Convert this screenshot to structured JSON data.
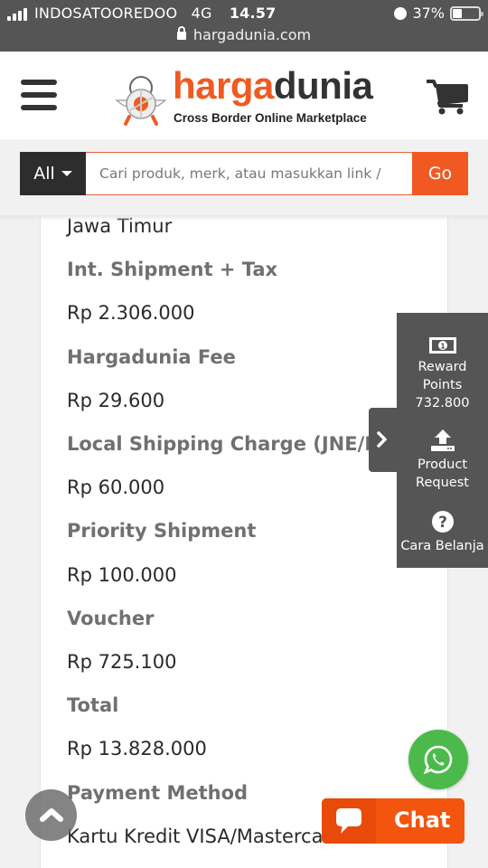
{
  "status_bar": {
    "carrier": "INDOSATOOREDOO",
    "network": "4G",
    "time": "14.57",
    "battery_percent": "37%",
    "battery_level": 0.37,
    "url": "hargadunia.com"
  },
  "header": {
    "logo_part1": "harga",
    "logo_part2": "dunia",
    "tagline": "Cross Border Online Marketplace"
  },
  "search": {
    "category": "All",
    "placeholder": "Cari produk, merk, atau masukkan link /",
    "value": "",
    "go_label": "Go"
  },
  "order_summary": {
    "rows": [
      {
        "type": "value",
        "text": "Jawa Timur"
      },
      {
        "type": "label",
        "text": "Int. Shipment + Tax"
      },
      {
        "type": "value",
        "text": "Rp 2.306.000"
      },
      {
        "type": "label",
        "text": "Hargadunia Fee"
      },
      {
        "type": "value",
        "text": "Rp 29.600"
      },
      {
        "type": "label",
        "text": "Local Shipping Charge (JNE/REX)"
      },
      {
        "type": "value",
        "text": "Rp 60.000"
      },
      {
        "type": "label",
        "text": "Priority Shipment"
      },
      {
        "type": "value",
        "text": "Rp 100.000"
      },
      {
        "type": "label",
        "text": "Voucher"
      },
      {
        "type": "value",
        "text": "Rp 725.100"
      },
      {
        "type": "label",
        "text": "Total"
      },
      {
        "type": "value",
        "text": "Rp 13.828.000"
      },
      {
        "type": "label",
        "text": "Payment Method"
      },
      {
        "type": "value",
        "text": "Kartu Kredit VISA/Mastercard"
      }
    ]
  },
  "side_panel": {
    "reward_label_1": "Reward",
    "reward_label_2": "Points",
    "reward_value": "732.800",
    "product_request_1": "Product",
    "product_request_2": "Request",
    "cara_belanja": "Cara Belanja"
  },
  "floating": {
    "chat_label": "Chat"
  },
  "colors": {
    "brand_orange": "#f05a22",
    "dark": "#2d2d2d",
    "panel_gray": "#555555",
    "whatsapp_green": "#4cba4a"
  }
}
